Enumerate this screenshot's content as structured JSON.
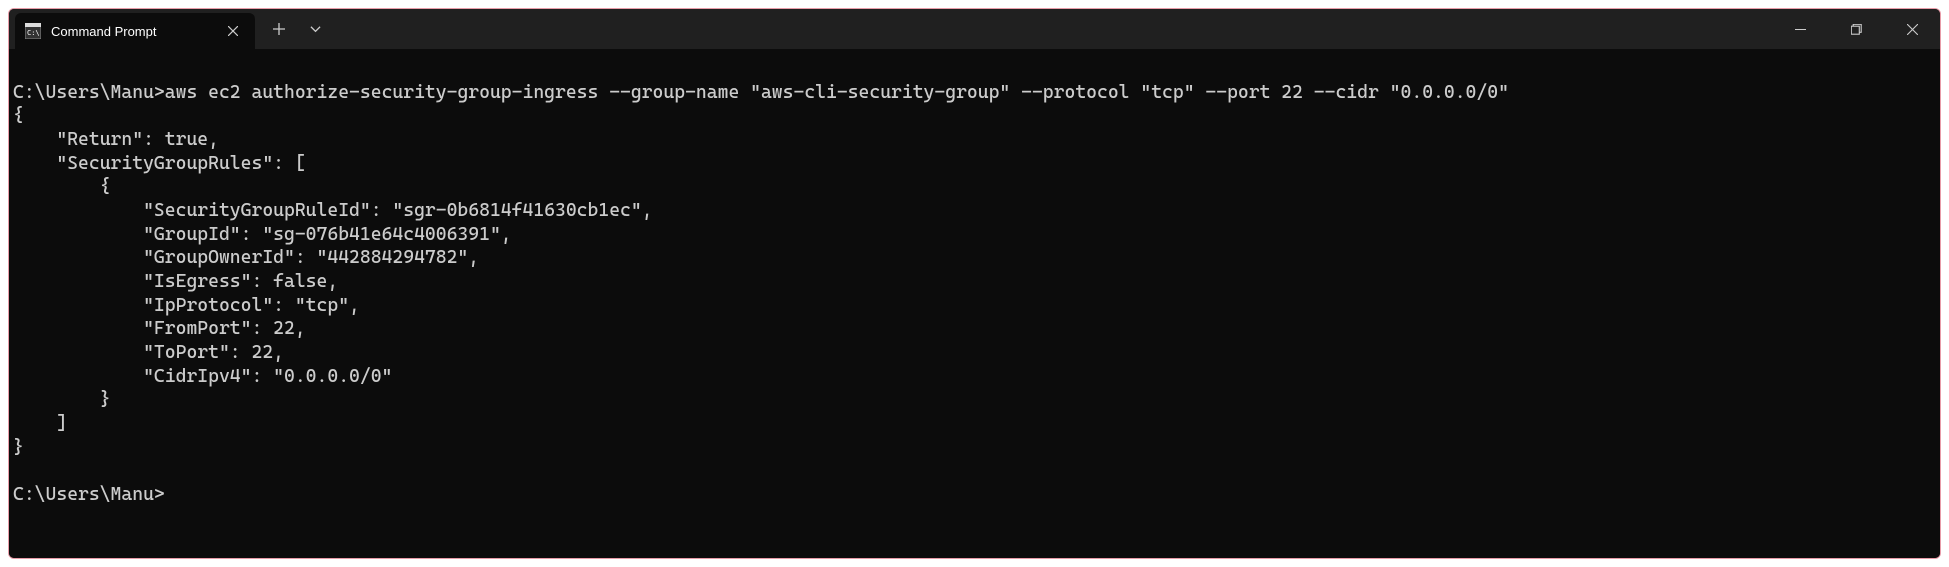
{
  "titlebar": {
    "tab_title": "Command Prompt"
  },
  "terminal": {
    "prompt1": "C:\\Users\\Manu>",
    "command": "aws ec2 authorize-security-group-ingress --group-name \"aws-cli-security-group\" --protocol \"tcp\" --port 22 --cidr \"0.0.0.0/0\"",
    "output_line1": "{",
    "output_line2": "    \"Return\": true,",
    "output_line3": "    \"SecurityGroupRules\": [",
    "output_line4": "        {",
    "output_line5": "            \"SecurityGroupRuleId\": \"sgr-0b6814f41630cb1ec\",",
    "output_line6": "            \"GroupId\": \"sg-076b41e64c4006391\",",
    "output_line7": "            \"GroupOwnerId\": \"442884294782\",",
    "output_line8": "            \"IsEgress\": false,",
    "output_line9": "            \"IpProtocol\": \"tcp\",",
    "output_line10": "            \"FromPort\": 22,",
    "output_line11": "            \"ToPort\": 22,",
    "output_line12": "            \"CidrIpv4\": \"0.0.0.0/0\"",
    "output_line13": "        }",
    "output_line14": "    ]",
    "output_line15": "}",
    "blank": "",
    "prompt2": "C:\\Users\\Manu>"
  }
}
